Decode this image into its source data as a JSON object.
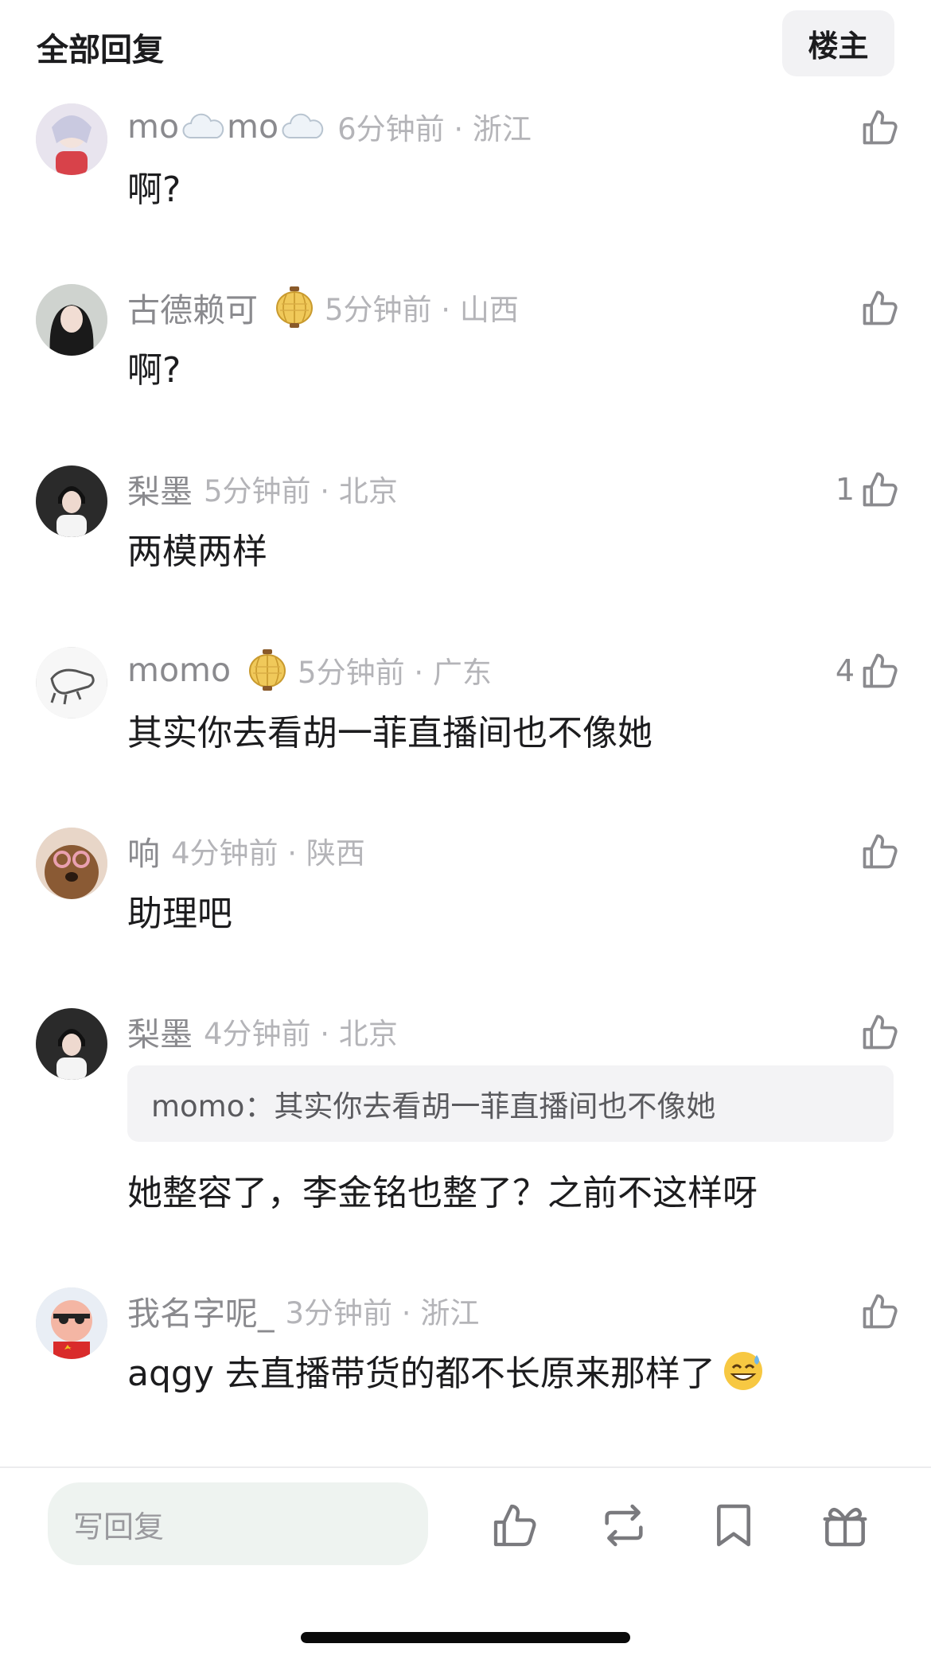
{
  "header": {
    "title": "全部回复",
    "owner_button": "楼主"
  },
  "comments": [
    {
      "user": "mo",
      "user2": "mo",
      "time": "6分钟前 · 浙江",
      "likes": "",
      "text": "啊?"
    },
    {
      "user": "古德赖可",
      "time": "5分钟前 · 山西",
      "likes": "",
      "text": "啊?"
    },
    {
      "user": "梨墨",
      "time": "5分钟前 · 北京",
      "likes": "1",
      "text": "两模两样"
    },
    {
      "user": "momo",
      "time": "5分钟前 · 广东",
      "likes": "4",
      "text": "其实你去看胡一菲直播间也不像她"
    },
    {
      "user": "响",
      "time": "4分钟前 · 陕西",
      "likes": "",
      "text": "助理吧"
    },
    {
      "user": "梨墨",
      "time": "4分钟前 · 北京",
      "likes": "",
      "quote": "momo：其实你去看胡一菲直播间也不像她",
      "text": "她整容了，李金铭也整了？之前不这样呀"
    },
    {
      "user": "我名字呢_",
      "time": "3分钟前 · 浙江",
      "likes": "",
      "text": "aqgy 去直播带货的都不长原来那样了"
    }
  ],
  "footer": {
    "reply_placeholder": "写回复"
  },
  "icons": {
    "like": "thumbs-up-icon",
    "repost": "repost-icon",
    "bookmark": "bookmark-icon",
    "gift": "gift-icon"
  },
  "colors": {
    "text_primary": "#1c1c1e",
    "text_secondary": "#8a8a8e",
    "text_tertiary": "#b4b4b8",
    "quote_bg": "#f3f3f5",
    "input_bg": "#eef3f0"
  }
}
